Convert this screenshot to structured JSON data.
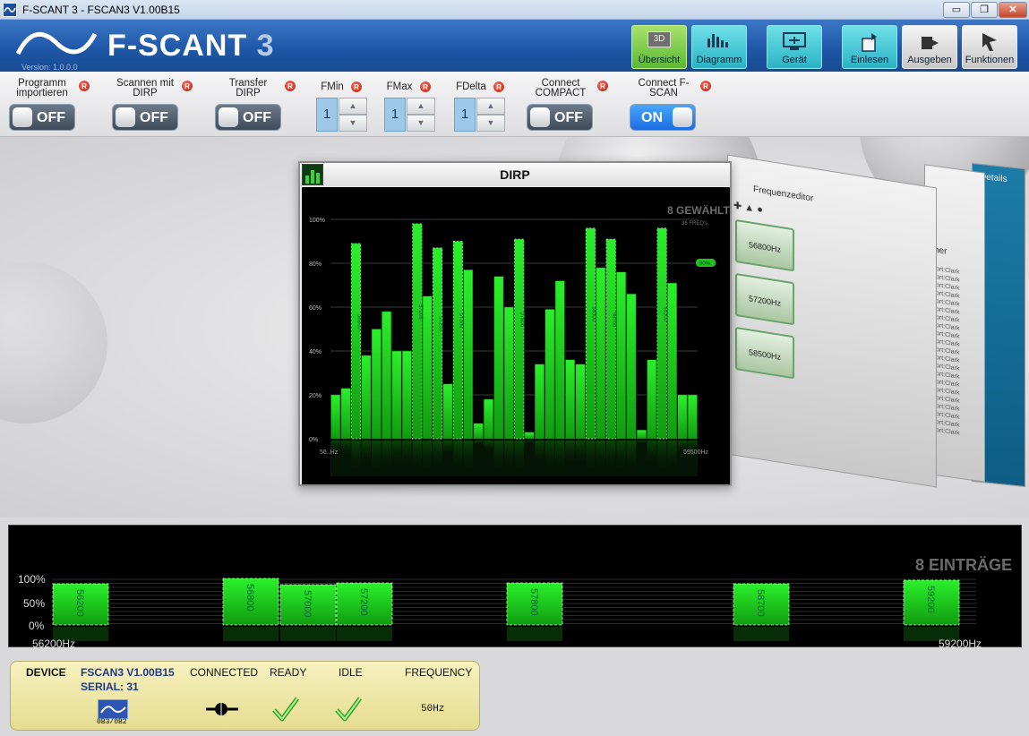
{
  "window": {
    "title": "F-SCANT 3 - FSCAN3 V1.00B15",
    "min_label": "▭",
    "max_label": "❐",
    "close_label": "✕"
  },
  "header": {
    "brand_main": "F-SCANT",
    "brand_num": "3",
    "version": "Version: 1.0.0.0",
    "buttons": [
      {
        "label": "Übersicht",
        "icon": "3d-icon",
        "badge": "3D"
      },
      {
        "label": "Diagramm",
        "icon": "bar-chart-icon"
      },
      {
        "label": "Gerät",
        "icon": "device-icon"
      },
      {
        "label": "Einlesen",
        "icon": "import-icon"
      },
      {
        "label": "Ausgeben",
        "icon": "export-icon"
      },
      {
        "label": "Funktionen",
        "icon": "function-icon"
      }
    ]
  },
  "options": {
    "programm_label": "Programm importieren",
    "scannen_label": "Scannen mit DIRP",
    "transfer_label": "Transfer DIRP",
    "fmin_label": "FMin",
    "fmax_label": "FMax",
    "fdelta_label": "FDelta",
    "compact_label": "Connect COMPACT",
    "fscan_label": "Connect F-SCAN",
    "r_badge": "R",
    "off": "OFF",
    "on": "ON",
    "fmin_value": "1",
    "fmax_value": "1",
    "fdelta_value": "1"
  },
  "dirp": {
    "title": "DIRP",
    "selected": "8 GEWÄHLT",
    "selected_sub": "36 FREQ's",
    "badge": "80%",
    "yticks": [
      "100%",
      "80%",
      "60%",
      "40%",
      "20%",
      "0%"
    ],
    "xmin": "56..Hz",
    "xmax": "59500Hz"
  },
  "chart_data": {
    "type": "bar",
    "title": "DIRP",
    "ylim": [
      0,
      100
    ],
    "values": [
      20,
      23,
      89,
      38,
      50,
      58,
      40,
      40,
      98,
      65,
      87,
      25,
      90,
      77,
      7,
      18,
      74,
      60,
      91,
      3,
      34,
      59,
      72,
      36,
      34,
      96,
      78,
      91,
      76,
      66,
      4,
      36,
      96,
      71,
      20,
      20
    ],
    "highlighted_labels": [
      "56800",
      "57200",
      "57200",
      "57300",
      "57800",
      "58500",
      "58700",
      "59200"
    ]
  },
  "side_panel": {
    "title": "Frequenzeditor",
    "cards": [
      "56800Hz",
      "57200Hz",
      "58500Hz"
    ],
    "details": "Details",
    "sort_label": "ner",
    "sort_item": "ort:Clark"
  },
  "strip": {
    "count": "8 EINTRÄGE",
    "y100": "100%",
    "y50": "50%",
    "y0": "0%",
    "xmin": "56200Hz",
    "xmax": "59200Hz",
    "entries": [
      "56200",
      "56800",
      "57000",
      "57200",
      "57800",
      "58700",
      "59200"
    ]
  },
  "status": {
    "device_label": "DEVICE",
    "device_name": "FSCAN3 V1.00B15",
    "serial": "SERIAL: 31",
    "device_code": "0B3/0B2",
    "connected": "CONNECTED",
    "ready": "READY",
    "idle": "IDLE",
    "frequency": "FREQUENCY",
    "freq_value": "50Hz"
  }
}
